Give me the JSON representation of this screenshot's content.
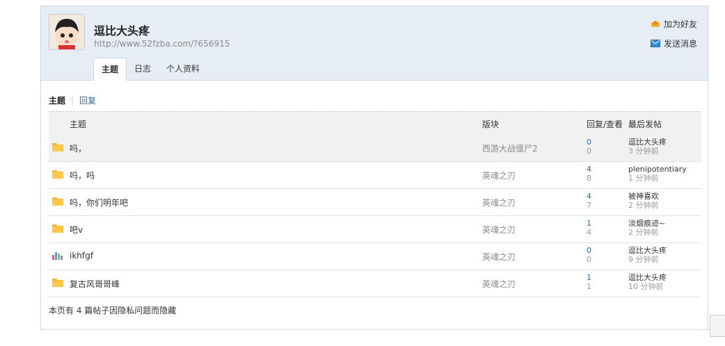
{
  "profile": {
    "username": "逗比大头疼",
    "url": "http://www.52fzba.com/?656915",
    "add_friend": "加为好友",
    "send_message": "发送消息"
  },
  "tabs": [
    {
      "label": "主题"
    },
    {
      "label": "日志"
    },
    {
      "label": "个人资料"
    }
  ],
  "subtabs": {
    "topics": "主题",
    "replies": "回复"
  },
  "table": {
    "headers": {
      "subject": "主题",
      "forum": "版块",
      "counts": "回复/查看",
      "last_post": "最后发帖"
    },
    "rows": [
      {
        "subject": "吗，",
        "forum": "西游大战僵尸2",
        "replies": "0",
        "views": "0",
        "last_user": "逗比大头疼",
        "last_time": "3 分钟前",
        "icon": "folder-icon"
      },
      {
        "subject": "吗，吗",
        "forum": "英魂之刃",
        "replies": "4",
        "views": "8",
        "last_user": "plenipotentiary",
        "last_time": "1 分钟前",
        "icon": "folder-icon"
      },
      {
        "subject": "吗，你们明年吧",
        "forum": "英魂之刃",
        "replies": "4",
        "views": "7",
        "last_user": "被神喜欢",
        "last_time": "2 分钟前",
        "icon": "folder-icon"
      },
      {
        "subject": "吧v",
        "forum": "英魂之刃",
        "replies": "1",
        "views": "4",
        "last_user": "淡烟痕迹~",
        "last_time": "2 分钟前",
        "icon": "folder-icon"
      },
      {
        "subject": "ikhfgf",
        "forum": "英魂之刃",
        "replies": "0",
        "views": "0",
        "last_user": "逗比大头疼",
        "last_time": "9 分钟前",
        "icon": "poll-icon"
      },
      {
        "subject": "复古风哥哥峰",
        "forum": "英魂之刃",
        "replies": "1",
        "views": "1",
        "last_user": "逗比大头疼",
        "last_time": "10 分钟前",
        "icon": "folder-icon"
      }
    ]
  },
  "note": "本页有 4 篇帖子因隐私问题而隐藏"
}
